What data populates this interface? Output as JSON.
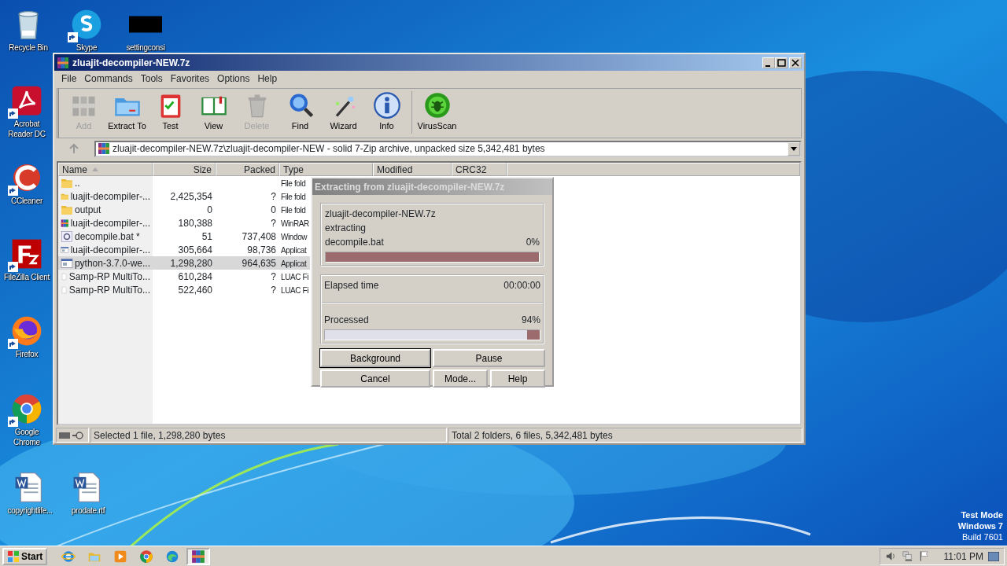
{
  "desktop_icons": [
    {
      "label": "Recycle Bin",
      "kind": "recycle",
      "shortcut": false
    },
    {
      "label": "Skype",
      "kind": "skype",
      "shortcut": true
    },
    {
      "label": "settingconsi",
      "kind": "redacted",
      "shortcut": false
    },
    {
      "label": "Acrobat Reader DC",
      "kind": "acrobat",
      "shortcut": true
    },
    {
      "label": "CCleaner",
      "kind": "ccleaner",
      "shortcut": true
    },
    {
      "label": "FileZilla Client",
      "kind": "filezilla",
      "shortcut": true
    },
    {
      "label": "Firefox",
      "kind": "firefox",
      "shortcut": true
    },
    {
      "label": "Google Chrome",
      "kind": "chrome",
      "shortcut": true
    },
    {
      "label": "copyrightlife...",
      "kind": "word",
      "shortcut": false
    },
    {
      "label": "prodate.rtf",
      "kind": "word",
      "shortcut": false
    }
  ],
  "window": {
    "title": "zluajit-decompiler-NEW.7z",
    "menu": [
      "File",
      "Commands",
      "Tools",
      "Favorites",
      "Options",
      "Help"
    ],
    "toolbar": [
      {
        "label": "Add",
        "kind": "add",
        "disabled": true
      },
      {
        "label": "Extract To",
        "kind": "extract",
        "disabled": false
      },
      {
        "label": "Test",
        "kind": "test",
        "disabled": false
      },
      {
        "label": "View",
        "kind": "view",
        "disabled": false
      },
      {
        "label": "Delete",
        "kind": "delete",
        "disabled": true
      },
      {
        "label": "Find",
        "kind": "find",
        "disabled": false
      },
      {
        "label": "Wizard",
        "kind": "wizard",
        "disabled": false
      },
      {
        "label": "Info",
        "kind": "info",
        "disabled": false
      },
      {
        "label": "VirusScan",
        "kind": "virus",
        "disabled": false
      }
    ],
    "address": "zluajit-decompiler-NEW.7z\\zluajit-decompiler-NEW - solid 7-Zip archive, unpacked size 5,342,481 bytes",
    "columns": [
      "Name",
      "Size",
      "Packed",
      "Type",
      "Modified",
      "CRC32"
    ],
    "rows": [
      {
        "name": "..",
        "size": "",
        "packed": "",
        "type": "File fold",
        "kind": "folder",
        "selected": false
      },
      {
        "name": "luajit-decompiler-...",
        "size": "2,425,354",
        "packed": "?",
        "type": "File fold",
        "kind": "folder",
        "selected": false
      },
      {
        "name": "output",
        "size": "0",
        "packed": "0",
        "type": "File fold",
        "kind": "folder",
        "selected": false
      },
      {
        "name": "luajit-decompiler-...",
        "size": "180,388",
        "packed": "?",
        "type": "WinRAR",
        "kind": "rar",
        "selected": false
      },
      {
        "name": "decompile.bat *",
        "size": "51",
        "packed": "737,408",
        "type": "Window",
        "kind": "bat",
        "selected": false
      },
      {
        "name": "luajit-decompiler-...",
        "size": "305,664",
        "packed": "98,736",
        "type": "Applicat",
        "kind": "exe",
        "selected": false
      },
      {
        "name": "python-3.7.0-we...",
        "size": "1,298,280",
        "packed": "964,635",
        "type": "Applicat",
        "kind": "exe",
        "selected": true
      },
      {
        "name": "Samp-RP MultiTo...",
        "size": "610,284",
        "packed": "?",
        "type": "LUAC Fi",
        "kind": "file",
        "selected": false
      },
      {
        "name": "Samp-RP MultiTo...",
        "size": "522,460",
        "packed": "?",
        "type": "LUAC Fi",
        "kind": "file",
        "selected": false
      }
    ],
    "status_left": "Selected 1 file, 1,298,280 bytes",
    "status_right": "Total 2 folders, 6 files, 5,342,481 bytes"
  },
  "dialog": {
    "title": "Extracting from zluajit-decompiler-NEW.7z",
    "archive": "zluajit-decompiler-NEW.7z",
    "action": "extracting",
    "file": "decompile.bat",
    "file_percent": "0%",
    "file_progress": {
      "level": 0
    },
    "elapsed_label": "Elapsed time",
    "elapsed": "00:00:00",
    "processed_label": "Processed",
    "processed_percent": "94%",
    "processed_progress": {
      "level": 0.94
    },
    "buttons": [
      {
        "label": "Background",
        "focused": true
      },
      {
        "label": "Pause",
        "focused": false
      },
      {
        "label": "Cancel",
        "focused": false
      },
      {
        "label": "Mode...",
        "focused": false
      },
      {
        "label": "Help",
        "focused": false
      }
    ]
  },
  "taskbar": {
    "start": "Start",
    "items": [
      {
        "kind": "ie",
        "selected": false
      },
      {
        "kind": "explorer",
        "selected": false
      },
      {
        "kind": "media",
        "selected": false
      },
      {
        "kind": "chrome",
        "selected": false
      },
      {
        "kind": "edge",
        "selected": false
      },
      {
        "kind": "rar",
        "selected": true
      }
    ],
    "time": "11:01 PM"
  },
  "watermark_text": [
    "Test Mode",
    "Windows 7",
    "Build 7601"
  ]
}
